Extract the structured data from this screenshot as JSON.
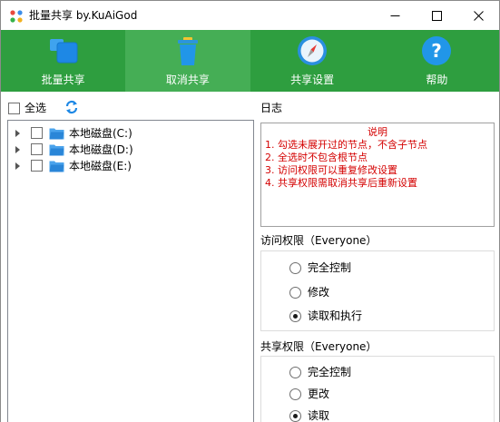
{
  "window": {
    "title": "批量共享 by.KuAiGod"
  },
  "toolbar": {
    "items": [
      {
        "label": "批量共享",
        "icon": "windows-tiles-icon"
      },
      {
        "label": "取消共享",
        "icon": "trash-bin-icon"
      },
      {
        "label": "共享设置",
        "icon": "compass-icon"
      },
      {
        "label": "帮助",
        "icon": "help-icon"
      }
    ],
    "active_index": 1,
    "colors": {
      "bar": "#2e9e3f",
      "active": "#45ae55"
    }
  },
  "left": {
    "select_all_label": "全选",
    "drives": [
      {
        "label": "本地磁盘(C:)"
      },
      {
        "label": "本地磁盘(D:)"
      },
      {
        "label": "本地磁盘(E:)"
      }
    ]
  },
  "log": {
    "label": "日志",
    "title": "说明",
    "lines": [
      "1. 勾选未展开过的节点，不含子节点",
      "2. 全选时不包含根节点",
      "3. 访问权限可以重复修改设置",
      "4. 共享权限需取消共享后重新设置"
    ],
    "text_color": "#d40000"
  },
  "access": {
    "label": "访问权限（Everyone）",
    "options": [
      "完全控制",
      "修改",
      "读取和执行"
    ],
    "selected": 2
  },
  "share": {
    "label": "共享权限（Everyone）",
    "options": [
      "完全控制",
      "更改",
      "读取"
    ],
    "selected": 2
  }
}
